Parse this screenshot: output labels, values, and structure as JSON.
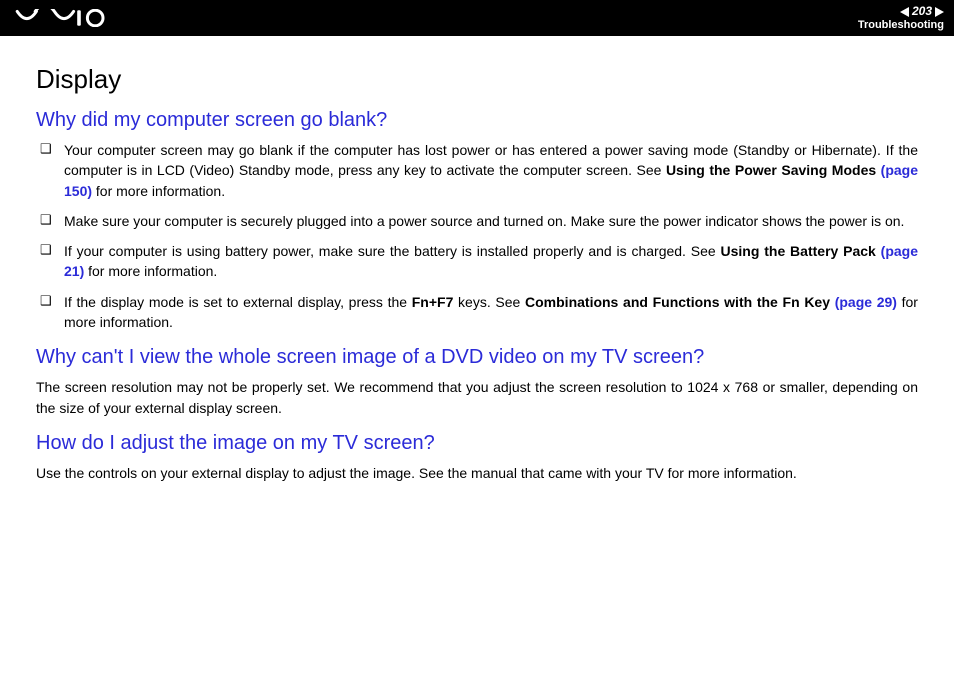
{
  "header": {
    "page_number": "203",
    "section": "Troubleshooting"
  },
  "page": {
    "title": "Display",
    "q1": {
      "heading": "Why did my computer screen go blank?",
      "b1_a": "Your computer screen may go blank if the computer has lost power or has entered a power saving mode (Standby or Hibernate). If the computer is in LCD (Video) Standby mode, press any key to activate the computer screen. See ",
      "b1_bold": "Using the Power Saving Modes ",
      "b1_link": "(page 150)",
      "b1_tail": " for more information.",
      "b2": "Make sure your computer is securely plugged into a power source and turned on. Make sure the power indicator shows the power is on.",
      "b3_a": "If your computer is using battery power, make sure the battery is installed properly and is charged. See ",
      "b3_bold": "Using the Battery Pack ",
      "b3_link": "(page 21)",
      "b3_tail": " for more information.",
      "b4_a": "If the display mode is set to external display, press the ",
      "b4_bold1": "Fn+F7",
      "b4_mid": " keys. See ",
      "b4_bold2": "Combinations and Functions with the Fn Key ",
      "b4_link": "(page 29)",
      "b4_tail": " for more information."
    },
    "q2": {
      "heading": "Why can't I view the whole screen image of a DVD video on my TV screen?",
      "p": "The screen resolution may not be properly set. We recommend that you adjust the screen resolution to 1024 x 768 or smaller, depending on the size of your external display screen."
    },
    "q3": {
      "heading": "How do I adjust the image on my TV screen?",
      "p": "Use the controls on your external display to adjust the image. See the manual that came with your TV for more information."
    }
  }
}
